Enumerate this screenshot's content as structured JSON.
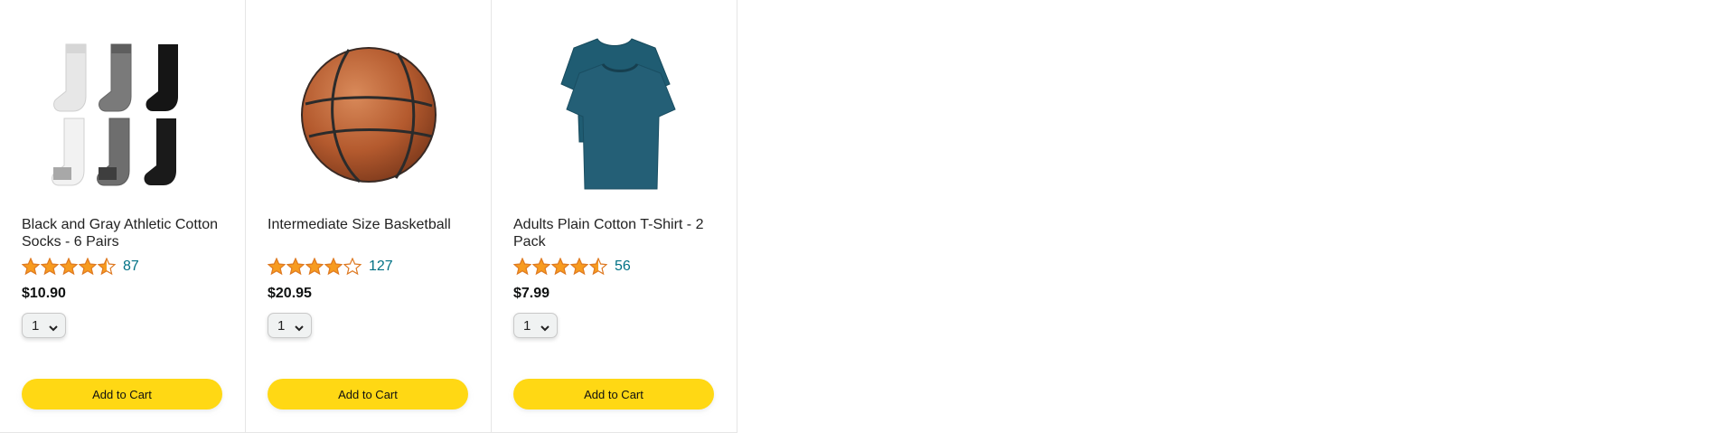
{
  "products": [
    {
      "image_icon": "athletic-socks-image",
      "name": "Black and Gray Athletic Cotton Socks - 6 Pairs",
      "rating_stars": 4.5,
      "rating_count": "87",
      "price": "$10.90",
      "quantity": "1",
      "add_label": "Add to Cart"
    },
    {
      "image_icon": "basketball-image",
      "name": "Intermediate Size Basketball",
      "rating_stars": 4,
      "rating_count": "127",
      "price": "$20.95",
      "quantity": "1",
      "add_label": "Add to Cart"
    },
    {
      "image_icon": "tshirt-image",
      "name": "Adults Plain Cotton T-Shirt - 2 Pack",
      "rating_stars": 4.5,
      "rating_count": "56",
      "price": "$7.99",
      "quantity": "1",
      "add_label": "Add to Cart"
    }
  ],
  "colors": {
    "star": "#f79b1f",
    "link": "#007185",
    "button": "#ffd814"
  }
}
